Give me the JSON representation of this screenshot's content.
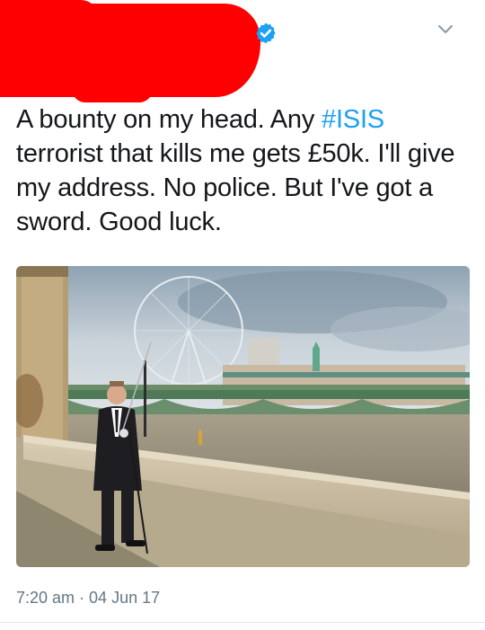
{
  "tweet": {
    "text_before_hashtag": "A bounty on my head. Any ",
    "hashtag": "#ISIS",
    "text_after_hashtag": " terrorist that kills me gets £50k. I'll give my address. No police. But I've got a sword. Good luck.",
    "time": "7:20 am",
    "separator": " · ",
    "date": "04 Jun 17"
  },
  "icons": {
    "verified": "verified-badge-icon",
    "menu": "chevron-down-icon"
  },
  "colors": {
    "text": "#14171a",
    "hashtag": "#1da1f2",
    "meta": "#657786",
    "redaction": "#ff0000",
    "verified": "#1da1f2"
  }
}
